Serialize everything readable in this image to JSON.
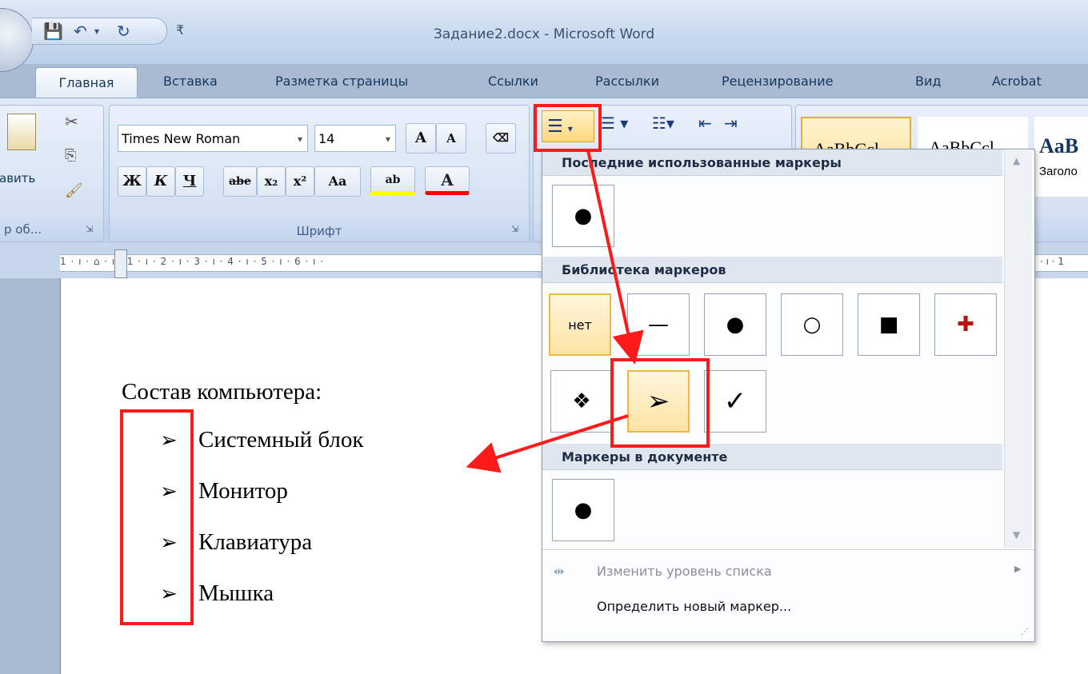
{
  "window": {
    "title": "Задание2.docx - Microsoft Word"
  },
  "tabs": [
    "Главная",
    "Вставка",
    "Разметка страницы",
    "Ссылки",
    "Рассылки",
    "Рецензирование",
    "Вид",
    "Acrobat"
  ],
  "clipboard": {
    "paste_label": "авить",
    "group_label": "р об..."
  },
  "font": {
    "name": "Times New Roman",
    "size": "14",
    "group_label": "Шрифт",
    "bold": "Ж",
    "italic": "К",
    "underline": "Ч",
    "strike": "abe",
    "sub": "x₂",
    "sup": "x²",
    "case": "Aa",
    "grow": "A",
    "shrink": "A",
    "highlight": "ab",
    "color": "A"
  },
  "styles": {
    "sample1": "AaBbCcl",
    "sample2": "AaBbCcl",
    "sample3": "AaB",
    "heading_label": "Заголо"
  },
  "ruler": {
    "text": "1 · ı · ⌂ · ı · 1 · ı · 2 · ı · 3 · ı · 4 · ı · 5 · ı · 6 · ı ·",
    "right_text": "· ı · 1"
  },
  "document": {
    "heading": "Состав компьютера:",
    "items": [
      "Системный блок",
      "Монитор",
      "Клавиатура",
      "Мышка"
    ],
    "bullet": "➢"
  },
  "dropdown": {
    "recent_header": "Последние использованные маркеры",
    "recent": [
      "●"
    ],
    "library_header": "Библиотека маркеров",
    "library": [
      "нет",
      "—",
      "●",
      "○",
      "■",
      "✚",
      "❖",
      "➢",
      "✓"
    ],
    "document_header": "Маркеры в документе",
    "document_markers": [
      "●"
    ],
    "change_level": "Изменить уровень списка",
    "define_new": "Определить новый маркер..."
  },
  "colors": {
    "annotation_red": "#ff1a1a",
    "selected_cell": "#ffe3a3",
    "ribbon": "#c9d9ef"
  }
}
